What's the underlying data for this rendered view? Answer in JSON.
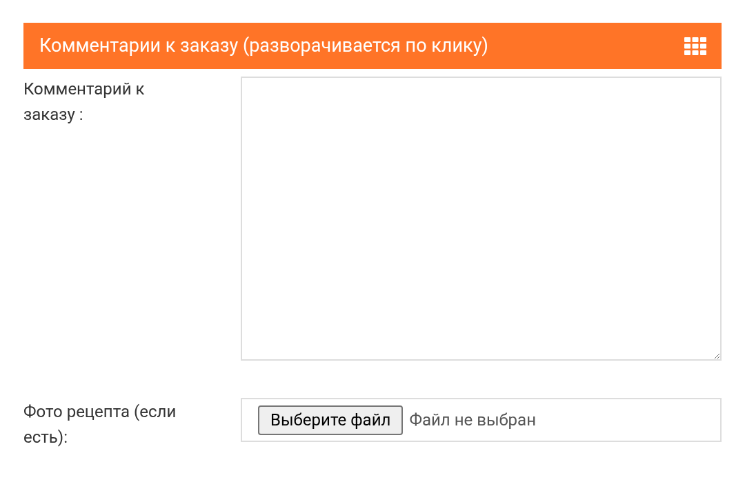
{
  "panel": {
    "title": "Комментарии к заказу (разворачивается по клику)"
  },
  "comment_field": {
    "label": "Комментарий к заказу :"
  },
  "photo_field": {
    "label": "Фото рецепта (если есть):",
    "button": "Выберите файл",
    "status": "Файл не выбран"
  }
}
